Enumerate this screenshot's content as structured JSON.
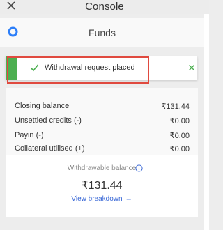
{
  "topbar": {
    "title": "Console",
    "close_icon": "close-icon"
  },
  "header": {
    "title": "Funds",
    "logo_icon": "brand-ring-icon"
  },
  "toast": {
    "message": "Withdrawal request placed",
    "check_icon": "check-icon",
    "close_icon": "close-icon",
    "accent_color": "#4caf50",
    "highlight_color": "#e04a3f"
  },
  "balances": [
    {
      "label": "Closing balance",
      "value": "₹131.44"
    },
    {
      "label": "Unsettled credits (-)",
      "value": "₹0.00"
    },
    {
      "label": "Payin (-)",
      "value": "₹0.00"
    },
    {
      "label": "Collateral utilised (+)",
      "value": "₹0.00"
    }
  ],
  "withdrawable": {
    "label": "Withdrawable balance",
    "info_icon": "info-icon",
    "amount": "₹131.44",
    "link_label": "View breakdown",
    "link_arrow": "→",
    "link_color": "#3867d6"
  }
}
